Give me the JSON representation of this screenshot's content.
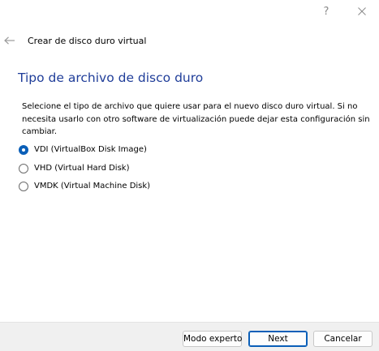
{
  "window": {
    "help_icon": "help-icon",
    "help_label": "?",
    "close_icon": "close-icon"
  },
  "header": {
    "back_icon": "back-arrow-icon",
    "wizard_title": "Crear de disco duro virtual"
  },
  "page": {
    "heading": "Tipo de archivo de disco duro",
    "description": "Selecione el tipo de archivo que quiere usar para el nuevo disco duro virtual. Si no necesita usarlo con otro software de virtualización puede dejar esta configuración sin cambiar."
  },
  "options": [
    {
      "label": "VDI (VirtualBox Disk Image)",
      "checked": true
    },
    {
      "label": "VHD (Virtual Hard Disk)",
      "checked": false
    },
    {
      "label": "VMDK (Virtual Machine Disk)",
      "checked": false
    }
  ],
  "footer": {
    "expert_label": "Modo experto",
    "next_label": "Next",
    "cancel_label": "Cancelar"
  },
  "colors": {
    "heading": "#1f3d99",
    "accent": "#0a5fb8",
    "footer_bg": "#f0f0f0"
  }
}
